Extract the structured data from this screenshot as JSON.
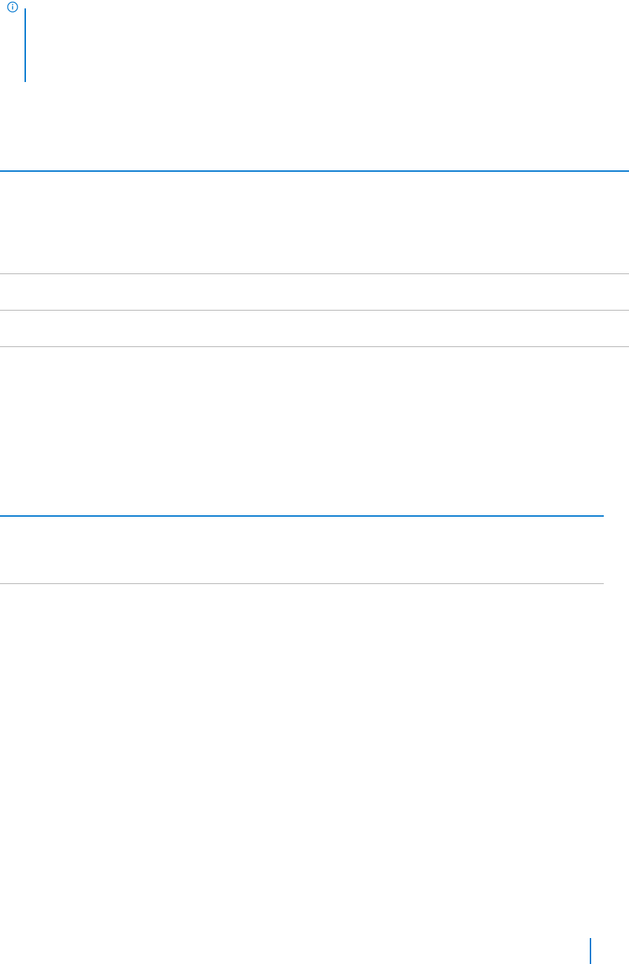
{
  "page": {
    "background": "#ffffff"
  },
  "note": {
    "icon": "info-circle-icon",
    "accent_color": "#0076ce"
  },
  "tables": [
    {
      "rule_top_color": "#0076ce",
      "row_rule_color": "#b0b0b0",
      "rows": [
        "",
        "",
        ""
      ]
    },
    {
      "rule_top_color": "#0076ce",
      "row_rule_color": "#b0b0b0",
      "rows": [
        ""
      ]
    }
  ],
  "footer": {
    "accent_color": "#0076ce"
  }
}
